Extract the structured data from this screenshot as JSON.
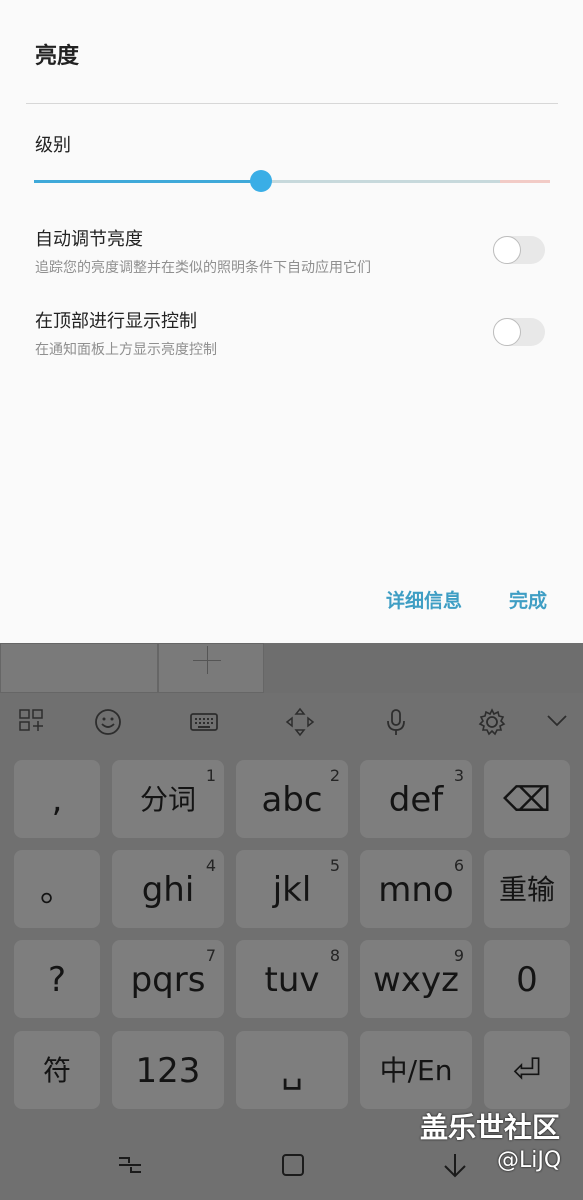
{
  "dialog": {
    "title": "亮度",
    "level_label": "级别",
    "slider_value": 0.44,
    "auto_brightness": {
      "title": "自动调节亮度",
      "subtitle": "追踪您的亮度调整并在类似的照明条件下自动应用它们",
      "enabled": false
    },
    "top_control": {
      "title": "在顶部进行显示控制",
      "subtitle": "在通知面板上方显示亮度控制",
      "enabled": false
    },
    "details_button": "详细信息",
    "done_button": "完成"
  },
  "keyboard": {
    "toolbar": [
      "apps-grid-icon",
      "emoji-icon",
      "keyboard-icon",
      "cursor-move-icon",
      "microphone-icon",
      "settings-icon",
      "collapse-chevron-icon"
    ],
    "rows": [
      [
        {
          "label": ","
        },
        {
          "label": "分词",
          "num": "1"
        },
        {
          "label": "abc",
          "num": "2"
        },
        {
          "label": "def",
          "num": "3"
        },
        {
          "label": "⌫"
        }
      ],
      [
        {
          "label": "。"
        },
        {
          "label": "ghi",
          "num": "4"
        },
        {
          "label": "jkl",
          "num": "5"
        },
        {
          "label": "mno",
          "num": "6"
        },
        {
          "label": "重输"
        }
      ],
      [
        {
          "label": "?"
        },
        {
          "label": "pqrs",
          "num": "7"
        },
        {
          "label": "tuv",
          "num": "8"
        },
        {
          "label": "wxyz",
          "num": "9"
        },
        {
          "label": "0"
        }
      ],
      [
        {
          "label": "符"
        },
        {
          "label": "123"
        },
        {
          "label": "␣"
        },
        {
          "label": "中/En"
        },
        {
          "label": "⏎"
        }
      ]
    ]
  },
  "navbar": {
    "icons": [
      "recent-apps-icon",
      "home-icon",
      "back-icon"
    ]
  },
  "watermark": {
    "text": "盖乐世社区",
    "handle": "@LiJQ"
  }
}
